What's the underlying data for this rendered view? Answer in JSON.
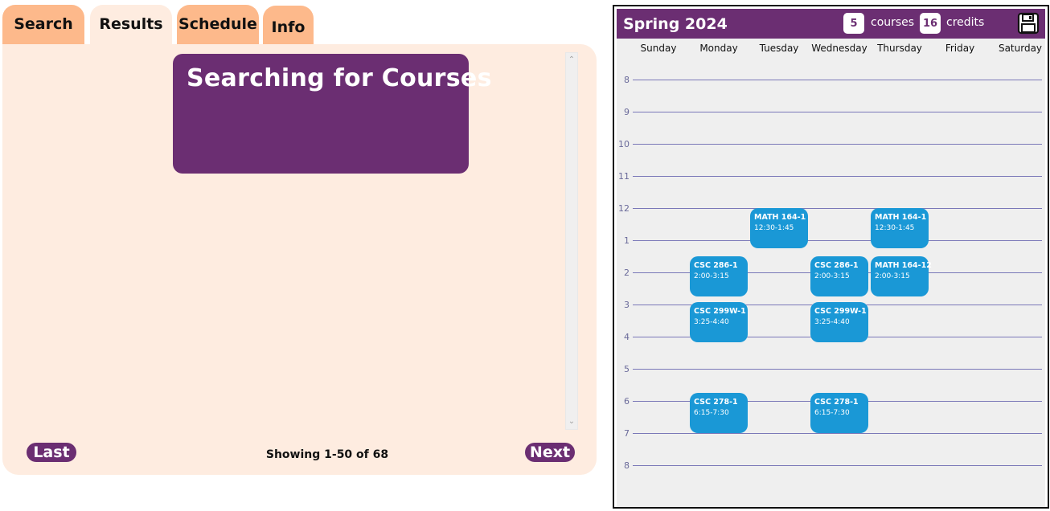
{
  "tabs": [
    {
      "label": "Search"
    },
    {
      "label": "Results"
    },
    {
      "label": "Schedule"
    },
    {
      "label": "Info"
    }
  ],
  "active_tab": "Results",
  "results": {
    "searching_title": "Searching for Courses",
    "last_label": "Last",
    "next_label": "Next",
    "showing_text": "Showing 1-50 of 68"
  },
  "schedule": {
    "term": "Spring 2024",
    "courses_count": "5",
    "courses_label": "courses",
    "credits_count": "16",
    "credits_label": "credits",
    "save_icon": "save-icon",
    "days": [
      "Sunday",
      "Monday",
      "Tuesday",
      "Wednesday",
      "Thursday",
      "Friday",
      "Saturday"
    ],
    "hours": [
      "8",
      "9",
      "10",
      "11",
      "12",
      "1",
      "2",
      "3",
      "4",
      "5",
      "6",
      "7",
      "8"
    ],
    "events": [
      {
        "code": "MATH 164-1",
        "time": "12:30-1:45",
        "day": "Tuesday"
      },
      {
        "code": "MATH 164-1",
        "time": "12:30-1:45",
        "day": "Thursday"
      },
      {
        "code": "CSC 286-1",
        "time": "2:00-3:15",
        "day": "Monday"
      },
      {
        "code": "CSC 286-1",
        "time": "2:00-3:15",
        "day": "Wednesday"
      },
      {
        "code": "MATH 164-12",
        "time": "2:00-3:15",
        "day": "Thursday"
      },
      {
        "code": "CSC 299W-1",
        "time": "3:25-4:40",
        "day": "Monday"
      },
      {
        "code": "CSC 299W-1",
        "time": "3:25-4:40",
        "day": "Wednesday"
      },
      {
        "code": "CSC 278-1",
        "time": "6:15-7:30",
        "day": "Monday"
      },
      {
        "code": "CSC 278-1",
        "time": "6:15-7:30",
        "day": "Wednesday"
      }
    ]
  },
  "colors": {
    "brand_purple": "#6b2e72",
    "tab_orange": "#fdb98b",
    "panel_bg": "#feece0",
    "event_blue": "#1a98d6",
    "grid_line": "#7a78b8",
    "calendar_bg": "#efefef"
  }
}
